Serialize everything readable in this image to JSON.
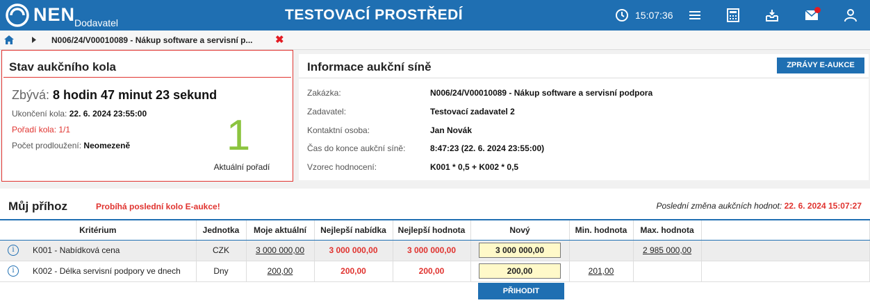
{
  "header": {
    "brand": "NEN",
    "brand_sub": "Dodavatel",
    "env_title": "TESTOVACÍ PROSTŘEDÍ",
    "clock": "15:07:36",
    "icons": [
      "clock-icon",
      "menu-icon",
      "calculator-icon",
      "inbox-download-icon",
      "mail-icon",
      "user-icon"
    ],
    "accent": "#1f6fb2",
    "notif_color": "#e31b23"
  },
  "breadcrumb": {
    "text": "N006/24/V00010089 - Nákup software a servisní p...",
    "close": "✖"
  },
  "stav": {
    "title": "Stav aukčního kola",
    "remain_label": "Zbývá:",
    "remain_value": "8 hodin 47 minut 23 sekund",
    "end_label": "Ukončení kola:",
    "end_value": "22. 6. 2024 23:55:00",
    "round_label": "Pořadí kola: 1/1",
    "ext_label": "Počet prodloužení:",
    "ext_value": "Neomezeně",
    "rank": "1",
    "rank_label": "Aktuální pořadí",
    "rank_color": "#8cc43f"
  },
  "info": {
    "title": "Informace aukční síně",
    "button": "ZPRÁVY E-AUKCE",
    "rows": [
      {
        "label": "Zakázka:",
        "value": "N006/24/V00010089 - Nákup software a servisní podpora"
      },
      {
        "label": "Zadavatel:",
        "value": "Testovací zadavatel 2"
      },
      {
        "label": "Kontaktní osoba:",
        "value": "Jan Novák"
      },
      {
        "label": "Čas do konce aukční síně:",
        "value": "8:47:23 (22. 6. 2024 23:55:00)"
      },
      {
        "label": "Vzorec hodnocení:",
        "value": "K001 * 0,5 + K002 * 0,5"
      }
    ]
  },
  "bid": {
    "title": "Můj příhoz",
    "warning": "Probíhá poslední kolo E-aukce!",
    "last_change_label": "Poslední změna aukčních hodnot:",
    "last_change_value": "22. 6. 2024 15:07:27",
    "columns": [
      "Kritérium",
      "Jednotka",
      "Moje aktuální",
      "Nejlepší nabídka",
      "Nejlepší hodnota",
      "Nový",
      "Min. hodnota",
      "Max. hodnota"
    ],
    "rows": [
      {
        "krit": "K001 - Nabídková cena",
        "unit": "CZK",
        "moje": "3 000 000,00",
        "best_offer": "3 000 000,00",
        "best_value": "3 000 000,00",
        "novy": "3 000 000,00",
        "min": "",
        "max": "2 985 000,00"
      },
      {
        "krit": "K002 - Délka servisní podpory ve dnech",
        "unit": "Dny",
        "moje": "200,00",
        "best_offer": "200,00",
        "best_value": "200,00",
        "novy": "200,00",
        "min": "201,00",
        "max": ""
      }
    ],
    "button": "PŘIHODIT"
  }
}
